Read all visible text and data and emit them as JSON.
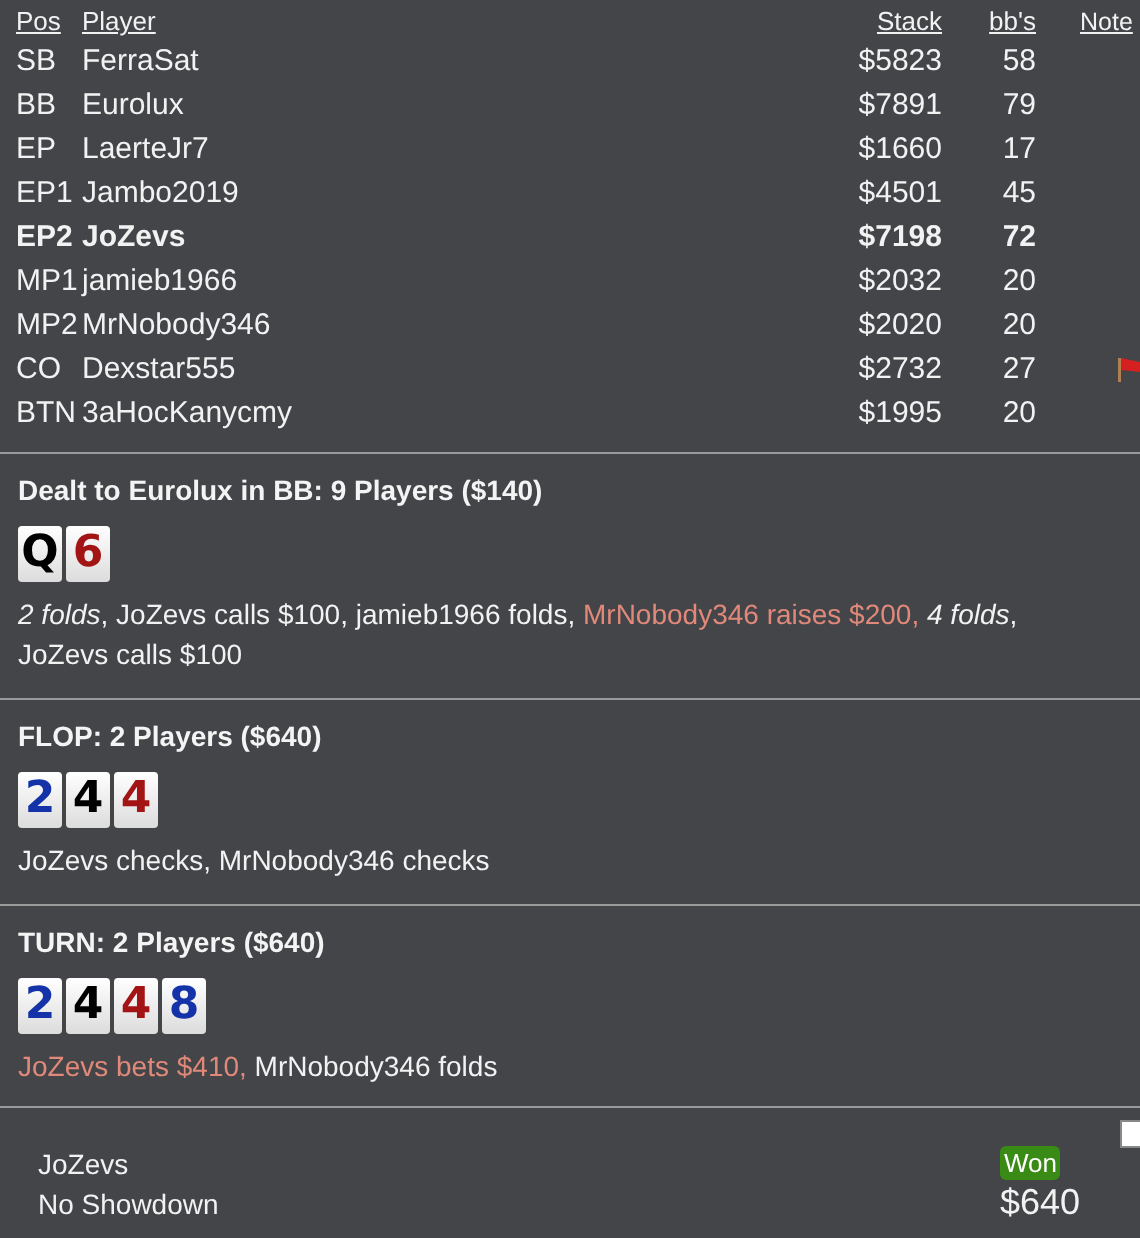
{
  "table": {
    "columns": [
      "Pos",
      "Player",
      "Stack",
      "bb's",
      "Note"
    ],
    "rows": [
      {
        "pos": "SB",
        "player": "FerraSat",
        "stack": "$5823",
        "bbs": "58",
        "hero": false,
        "note": false
      },
      {
        "pos": "BB",
        "player": "Eurolux",
        "stack": "$7891",
        "bbs": "79",
        "hero": false,
        "note": false
      },
      {
        "pos": "EP",
        "player": "LaerteJr7",
        "stack": "$1660",
        "bbs": "17",
        "hero": false,
        "note": false
      },
      {
        "pos": "EP1",
        "player": "Jambo2019",
        "stack": "$4501",
        "bbs": "45",
        "hero": false,
        "note": false
      },
      {
        "pos": "EP2",
        "player": "JoZevs",
        "stack": "$7198",
        "bbs": "72",
        "hero": true,
        "note": false
      },
      {
        "pos": "MP1",
        "player": "jamieb1966",
        "stack": "$2032",
        "bbs": "20",
        "hero": false,
        "note": false
      },
      {
        "pos": "MP2",
        "player": "MrNobody346",
        "stack": "$2020",
        "bbs": "20",
        "hero": false,
        "note": false
      },
      {
        "pos": "CO",
        "player": "Dexstar555",
        "stack": "$2732",
        "bbs": "27",
        "hero": false,
        "note": true
      },
      {
        "pos": "BTN",
        "player": "3aHocKanycmy",
        "stack": "$1995",
        "bbs": "20",
        "hero": false,
        "note": false
      }
    ]
  },
  "streets": [
    {
      "title": "Dealt to Eurolux in BB: 9 Players ($140)",
      "cards": [
        {
          "rank": "Q",
          "color": "#000000"
        },
        {
          "rank": "6",
          "color": "#a31515"
        }
      ],
      "actions": [
        {
          "kind": "italic",
          "text": "2 folds"
        },
        {
          "kind": "plain",
          "text": ", JoZevs calls $100, jamieb1966 folds, "
        },
        {
          "kind": "aggressive",
          "text": "MrNobody346 raises $200, "
        },
        {
          "kind": "italic",
          "text": "4 folds"
        },
        {
          "kind": "plain",
          "text": ", JoZevs calls $100"
        }
      ]
    },
    {
      "title": "FLOP: 2 Players ($640)",
      "cards": [
        {
          "rank": "2",
          "color": "#1533a8"
        },
        {
          "rank": "4",
          "color": "#000000"
        },
        {
          "rank": "4",
          "color": "#a31515"
        }
      ],
      "actions": [
        {
          "kind": "plain",
          "text": "JoZevs checks, MrNobody346 checks"
        }
      ]
    },
    {
      "title": "TURN: 2 Players ($640)",
      "cards": [
        {
          "rank": "2",
          "color": "#1533a8"
        },
        {
          "rank": "4",
          "color": "#000000"
        },
        {
          "rank": "4",
          "color": "#a31515"
        },
        {
          "rank": "8",
          "color": "#1533a8"
        }
      ],
      "actions": [
        {
          "kind": "aggressive",
          "text": "JoZevs bets $410, "
        },
        {
          "kind": "plain",
          "text": "MrNobody346 folds"
        }
      ]
    }
  ],
  "result": {
    "player": "JoZevs",
    "detail": "No Showdown",
    "badge": "Won",
    "amount": "$640",
    "checked": false
  }
}
